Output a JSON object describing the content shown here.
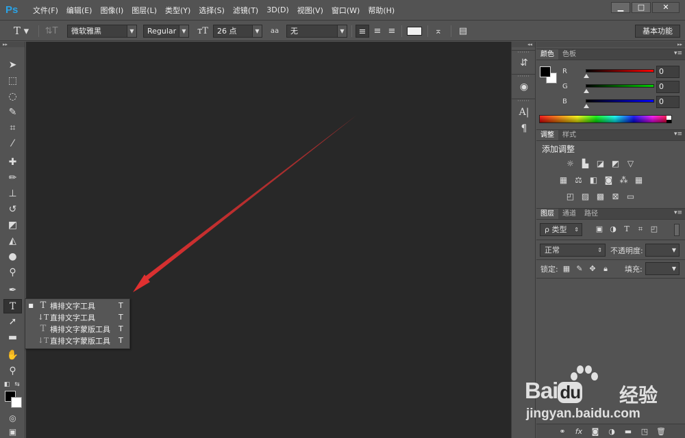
{
  "app": {
    "logo": "Ps"
  },
  "menu": [
    "文件(F)",
    "编辑(E)",
    "图像(I)",
    "图层(L)",
    "类型(Y)",
    "选择(S)",
    "滤镜(T)",
    "3D(D)",
    "视图(V)",
    "窗口(W)",
    "帮助(H)"
  ],
  "window_controls": {
    "minimize": "▁",
    "maximize": "□",
    "close": "✕"
  },
  "options": {
    "font_family": "微软雅黑",
    "font_style": "Regular",
    "font_size": "26 点",
    "antialias": "无",
    "antialias_label": "aa",
    "workspace": "基本功能"
  },
  "flyout": {
    "items": [
      {
        "label": "横排文字工具",
        "shortcut": "T",
        "icon": "T",
        "selected": true
      },
      {
        "label": "直排文字工具",
        "shortcut": "T",
        "icon": "↓T",
        "selected": false
      },
      {
        "label": "横排文字蒙版工具",
        "shortcut": "T",
        "icon": "T",
        "selected": false
      },
      {
        "label": "直排文字蒙版工具",
        "shortcut": "T",
        "icon": "↓T",
        "selected": false
      }
    ]
  },
  "color_panel": {
    "tabs": [
      "颜色",
      "色板"
    ],
    "channels": [
      {
        "label": "R",
        "value": "0",
        "color": "#ff0000"
      },
      {
        "label": "G",
        "value": "0",
        "color": "#00d000"
      },
      {
        "label": "B",
        "value": "0",
        "color": "#0000ff"
      }
    ]
  },
  "adjust_panel": {
    "tabs": [
      "调整",
      "样式"
    ],
    "title": "添加调整"
  },
  "layers_panel": {
    "tabs": [
      "图层",
      "通道",
      "路径"
    ],
    "filter_kind": "ρ 类型",
    "blend_mode": "正常",
    "opacity_label": "不透明度:",
    "lock_label": "锁定:",
    "fill_label": "填充:"
  },
  "watermark": {
    "brand": "Bai",
    "brand_paw": "du",
    "brand_cn": "经验",
    "url": "jingyan.baidu.com"
  },
  "colors": {
    "accent": "#2aa3e6",
    "arrow": "#e03030",
    "canvas": "#282828"
  }
}
